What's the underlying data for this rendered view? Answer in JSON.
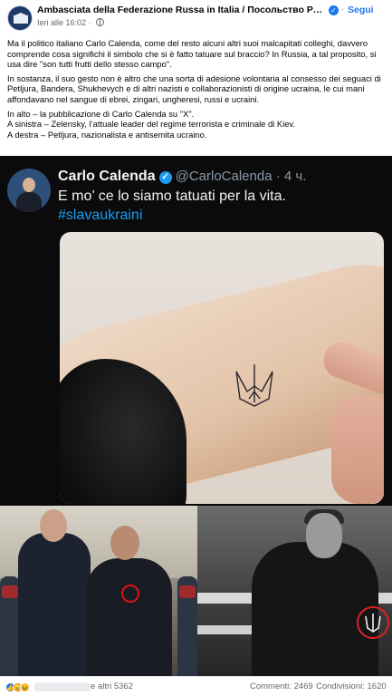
{
  "post": {
    "page_name": "Ambasciata della Federazione Russa in Italia / Посольство России в Ита...",
    "verified_glyph": "✓",
    "separator": "·",
    "follow_label": "Segui",
    "time": "Ieri alle 16:02",
    "meta_separator": "·",
    "privacy_icon": "globe-icon",
    "paragraphs": [
      "Ma il politico italiano Carlo Calenda, come del resto alcuni altri suoi malcapitati colleghi, davvero comprende cosa significhi il simbolo che si è fatto tatuare sul braccio? In Russia, a tal proposito, si usa dire \"son tutti frutti dello stesso campo\".",
      "In sostanza, il suo gesto non è altro che una sorta di adesione volontaria al consesso dei seguaci di Petljura, Bandera, Shukhevych e di altri nazisti e collaborazionisti di origine ucraina, le cui mani affondavano nel sangue di ebrei, zingari, ungheresi, russi e ucraini."
    ],
    "caption_lines": [
      "In alto – la pubblicazione di Carlo Calenda su \"X\".",
      "A sinistra – Zelensky, l’attuale leader del regime terrorista e criminale di Kiev.",
      "A destra – Petljura, nazionalista e antisemita ucraino."
    ]
  },
  "tweet": {
    "name": "Carlo Calenda",
    "verified_glyph": "✓",
    "handle": "@CarloCalenda · 4 ч.",
    "text": "E mo’ ce lo siamo tatuati per la vita.",
    "hashtag": "#slavaukraini"
  },
  "footer": {
    "reactions": [
      "like",
      "angry",
      "haha"
    ],
    "reactions_count": "e altri 5362",
    "comments": "Commenti: 2469",
    "shares": "Condivisioni: 1620"
  },
  "colors": {
    "accent": "#1877f2",
    "meta_gray": "#65676b",
    "tweet_bg": "#0b0b0b",
    "hashtag": "#1d9bf0",
    "highlight_ring": "#e02020"
  }
}
